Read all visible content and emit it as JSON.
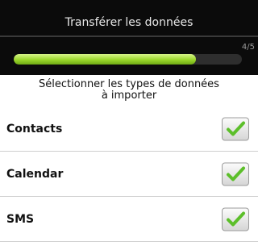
{
  "header": {
    "title": "Transférer les données",
    "progress_text": "4/5",
    "progress_fraction": 0.8
  },
  "panel": {
    "prompt_line1": "Sélectionner les types de données",
    "prompt_line2": "à importer",
    "items": [
      {
        "label": "Contacts",
        "checked": true
      },
      {
        "label": "Calendar",
        "checked": true
      },
      {
        "label": "SMS",
        "checked": true
      }
    ]
  },
  "colors": {
    "header_bg": "#0b0b0b",
    "progress_green": "#9bd62b",
    "check_green": "#5cbf2a"
  },
  "icons": {
    "checkbox": "checkmark-icon"
  }
}
